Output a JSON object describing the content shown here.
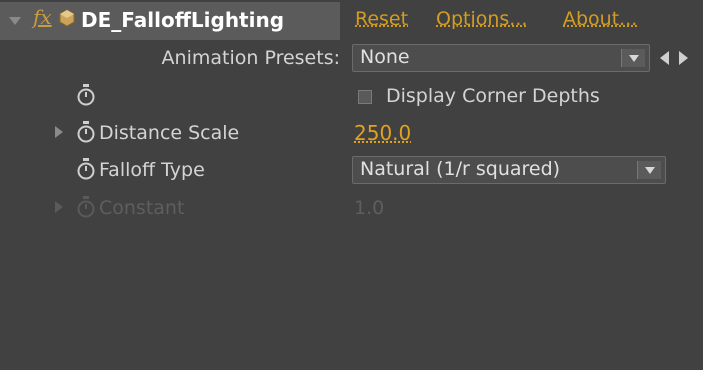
{
  "effect": {
    "name": "DE_FalloffLighting",
    "links": {
      "reset": "Reset",
      "options": "Options...",
      "about": "About..."
    }
  },
  "presets": {
    "label": "Animation Presets:",
    "value": "None"
  },
  "corner_depths": {
    "label": "Display Corner Depths",
    "checked": false
  },
  "params": [
    {
      "name": "Distance Scale",
      "value": "250.0",
      "enabled": true,
      "expandable": true
    },
    {
      "name": "Falloff Type",
      "value": "Natural (1/r squared)",
      "enabled": true,
      "expandable": false
    },
    {
      "name": "Constant",
      "value": "1.0",
      "enabled": false,
      "expandable": true
    }
  ],
  "colors": {
    "panel_bg": "#414141",
    "header_selected_bg": "#5b5b5b",
    "link": "#d39d1f",
    "value": "#e0a21f",
    "disabled_text": "#5e5e5e"
  }
}
